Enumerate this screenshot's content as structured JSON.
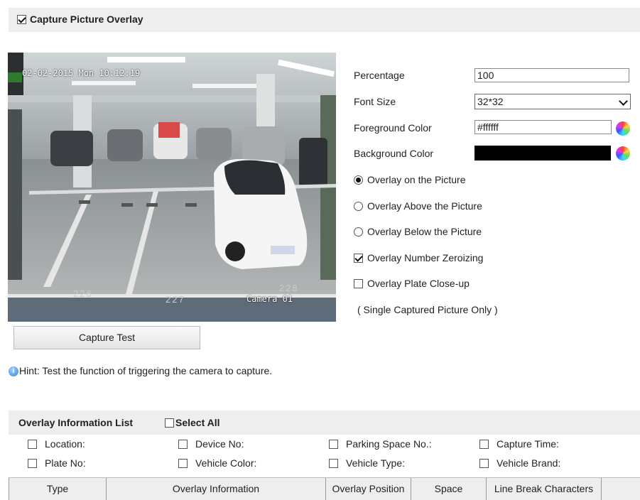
{
  "header": {
    "title": "Capture Picture Overlay",
    "checked": true
  },
  "camera": {
    "timestamp": "02-02-2015 Mon 10:12:19",
    "name": "Camera 01",
    "lots": [
      "226",
      "227",
      "228"
    ]
  },
  "capture_button": "Capture Test",
  "hint": "Hint: Test the function of triggering the camera to capture.",
  "settings": {
    "percentage_label": "Percentage",
    "percentage_value": "100",
    "font_size_label": "Font Size",
    "font_size_value": "32*32",
    "foreground_label": "Foreground Color",
    "foreground_value": "#ffffff",
    "background_label": "Background Color",
    "background_value": "#000000"
  },
  "options": {
    "on_picture": "Overlay on the Picture",
    "above_picture": "Overlay Above the Picture",
    "below_picture": "Overlay Below the Picture",
    "number_zeroizing": "Overlay Number Zeroizing",
    "plate_closeup": "Overlay Plate Close-up",
    "single_note": "( Single Captured Picture Only )"
  },
  "overlay_list": {
    "title": "Overlay Information List",
    "select_all": "Select All",
    "fields": [
      "Location:",
      "Device No:",
      "Parking Space No.:",
      "Capture Time:",
      "Plate No:",
      "Vehicle Color:",
      "Vehicle Type:",
      "Vehicle Brand:"
    ]
  },
  "table": {
    "columns": [
      "Type",
      "Overlay Information",
      "Overlay Position",
      "Space",
      "Line Break Characters"
    ]
  }
}
